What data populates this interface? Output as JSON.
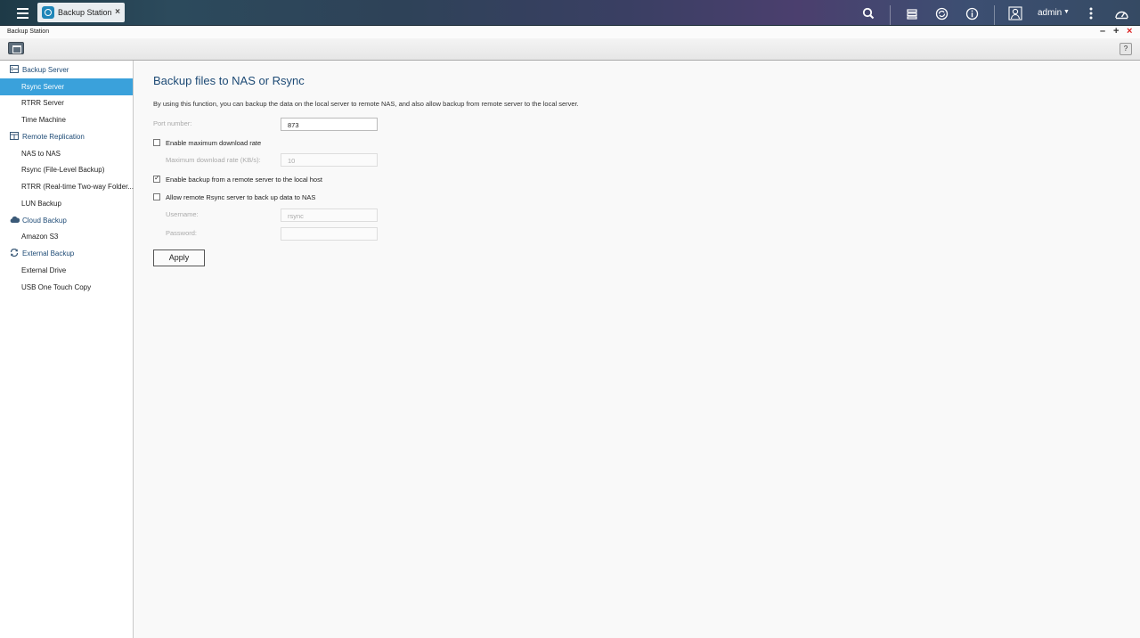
{
  "topbar": {
    "tab_label": "Backup Station",
    "user": "admin"
  },
  "window": {
    "title": "Backup Station"
  },
  "sidebar": {
    "groups": [
      {
        "label": "Backup Server",
        "items": [
          {
            "label": "Rsync Server",
            "active": true
          },
          {
            "label": "RTRR Server"
          },
          {
            "label": "Time Machine"
          }
        ]
      },
      {
        "label": "Remote Replication",
        "items": [
          {
            "label": "NAS to NAS"
          },
          {
            "label": "Rsync (File-Level Backup)"
          },
          {
            "label": "RTRR (Real-time Two-way Folder..."
          },
          {
            "label": "LUN Backup"
          }
        ]
      },
      {
        "label": "Cloud Backup",
        "items": [
          {
            "label": "Amazon S3"
          }
        ]
      },
      {
        "label": "External Backup",
        "items": [
          {
            "label": "External Drive"
          },
          {
            "label": "USB One Touch Copy"
          }
        ]
      }
    ]
  },
  "main": {
    "title": "Backup files to NAS or Rsync",
    "description": "By using this function, you can backup the data on the local server to remote NAS, and also allow backup from remote server to the local server.",
    "port_label": "Port number:",
    "port_value": "873",
    "max_rate_checkbox": "Enable maximum download rate",
    "max_rate_label": "Maximum download rate (KB/s):",
    "max_rate_value": "10",
    "enable_backup_checkbox": "Enable backup from a remote server to the local host",
    "allow_rsync_checkbox": "Allow remote Rsync server to back up data to NAS",
    "username_label": "Username:",
    "username_value": "rsync",
    "password_label": "Password:",
    "password_value": "",
    "apply_label": "Apply"
  },
  "checkboxes": {
    "max_rate": false,
    "enable_backup": true,
    "allow_rsync": false
  }
}
